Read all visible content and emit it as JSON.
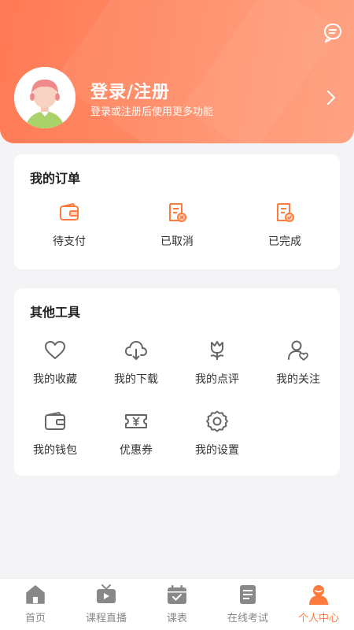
{
  "header": {
    "title": "登录/注册",
    "subtitle": "登录或注册后使用更多功能",
    "message_icon": "message-icon",
    "avatar": "default-avatar"
  },
  "orders": {
    "title": "我的订单",
    "items": [
      {
        "label": "待支付",
        "icon": "wallet-icon"
      },
      {
        "label": "已取消",
        "icon": "document-cancel-icon"
      },
      {
        "label": "已完成",
        "icon": "document-check-icon"
      }
    ]
  },
  "tools": {
    "title": "其他工具",
    "items": [
      {
        "label": "我的收藏",
        "icon": "heart-icon"
      },
      {
        "label": "我的下载",
        "icon": "cloud-download-icon"
      },
      {
        "label": "我的点评",
        "icon": "tulip-icon"
      },
      {
        "label": "我的关注",
        "icon": "user-heart-icon"
      },
      {
        "label": "我的钱包",
        "icon": "wallet-icon"
      },
      {
        "label": "优惠券",
        "icon": "coupon-icon"
      },
      {
        "label": "我的设置",
        "icon": "gear-icon"
      }
    ]
  },
  "tabbar": {
    "tabs": [
      {
        "label": "首页",
        "icon": "home-icon"
      },
      {
        "label": "课程直播",
        "icon": "live-tv-icon"
      },
      {
        "label": "课表",
        "icon": "calendar-icon"
      },
      {
        "label": "在线考试",
        "icon": "exam-icon"
      },
      {
        "label": "个人中心",
        "icon": "person-icon",
        "active": true
      }
    ]
  },
  "colors": {
    "accent": "#ff7a3d",
    "header_gradient_start": "#ff7a55",
    "header_gradient_end": "#ff9f7e",
    "icon_gray": "#666666",
    "tab_inactive": "#888888"
  }
}
